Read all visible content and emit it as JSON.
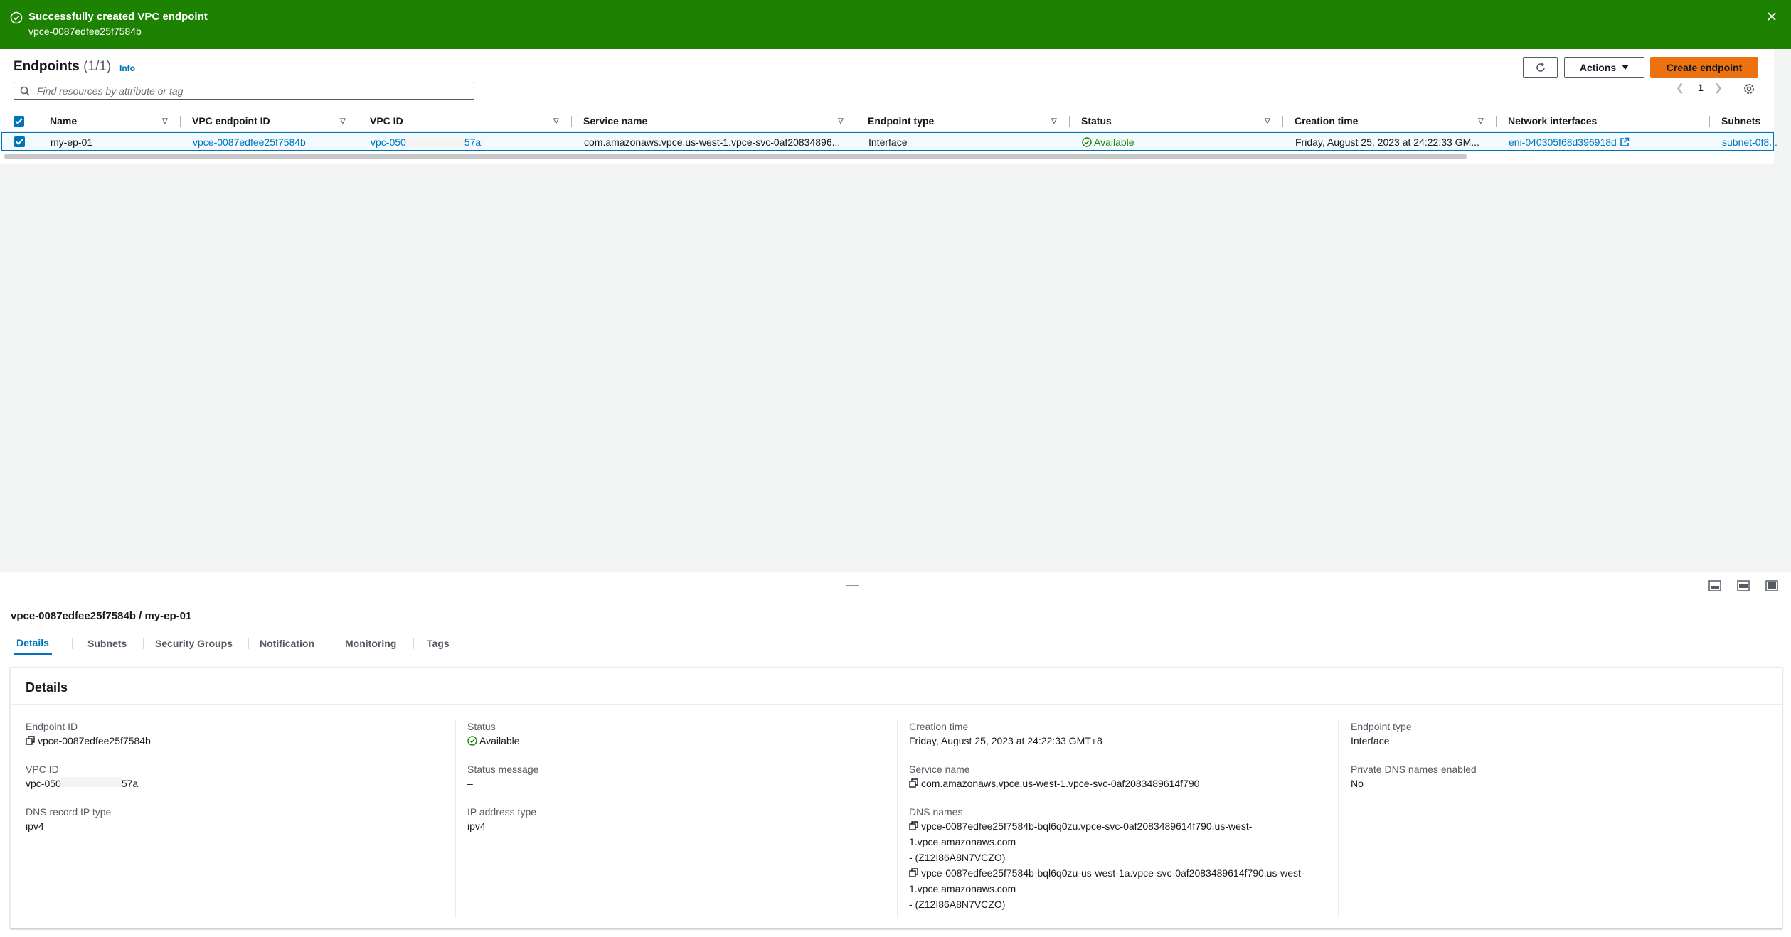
{
  "flash": {
    "title": "Successfully created VPC endpoint",
    "subtitle": "vpce-0087edfee25f7584b",
    "type_color": "#1d8102"
  },
  "endpoints": {
    "title": "Endpoints",
    "count": "(1/1)",
    "info_label": "Info",
    "actions_label": "Actions",
    "create_label": "Create endpoint",
    "search_placeholder": "Find resources by attribute or tag",
    "page": "1",
    "columns": [
      "Name",
      "VPC endpoint ID",
      "VPC ID",
      "Service name",
      "Endpoint type",
      "Status",
      "Creation time",
      "Network interfaces",
      "Subnets"
    ],
    "row": {
      "name": "my-ep-01",
      "endpoint_id": "vpce-0087edfee25f7584b",
      "vpc_id_prefix": "vpc-050",
      "vpc_id_suffix": "57a",
      "service_name": "com.amazonaws.vpce.us-west-1.vpce-svc-0af20834896...",
      "endpoint_type": "Interface",
      "status": "Available",
      "creation_time": "Friday, August 25, 2023 at 24:22:33 GM...",
      "network_interface": "eni-040305f68d396918d",
      "subnets": "subnet-0f8..."
    }
  },
  "split": {
    "title": "vpce-0087edfee25f7584b / my-ep-01",
    "tabs": [
      "Details",
      "Subnets",
      "Security Groups",
      "Notification",
      "Monitoring",
      "Tags"
    ],
    "section_title": "Details",
    "fields": {
      "endpoint_id_label": "Endpoint ID",
      "endpoint_id": "vpce-0087edfee25f7584b",
      "vpc_id_label": "VPC ID",
      "vpc_id_prefix": "vpc-050",
      "vpc_id_suffix": "57a",
      "dns_record_label": "DNS record IP type",
      "dns_record": "ipv4",
      "status_label": "Status",
      "status": "Available",
      "status_message_label": "Status message",
      "status_message": "–",
      "ip_address_type_label": "IP address type",
      "ip_address_type": "ipv4",
      "creation_time_label": "Creation time",
      "creation_time": "Friday, August 25, 2023 at 24:22:33 GMT+8",
      "service_name_label": "Service name",
      "service_name": "com.amazonaws.vpce.us-west-1.vpce-svc-0af2083489614f790",
      "dns_names_label": "DNS names",
      "dns_1_line1": "vpce-0087edfee25f7584b-bql6q0zu.vpce-svc-0af2083489614f790.us-west-",
      "dns_1_line2": "1.vpce.amazonaws.com",
      "dns_1_zone": "- (Z12I86A8N7VCZO)",
      "dns_2_line1": "vpce-0087edfee25f7584b-bql6q0zu-us-west-1a.vpce-svc-0af2083489614f790.us-west-",
      "dns_2_line2": "1.vpce.amazonaws.com",
      "dns_2_zone": "- (Z12I86A8N7VCZO)",
      "endpoint_type_label": "Endpoint type",
      "endpoint_type": "Interface",
      "private_dns_label": "Private DNS names enabled",
      "private_dns": "No"
    }
  },
  "colors": {
    "link": "#0073bb",
    "primary": "#ec7211",
    "success": "#1d8102"
  }
}
